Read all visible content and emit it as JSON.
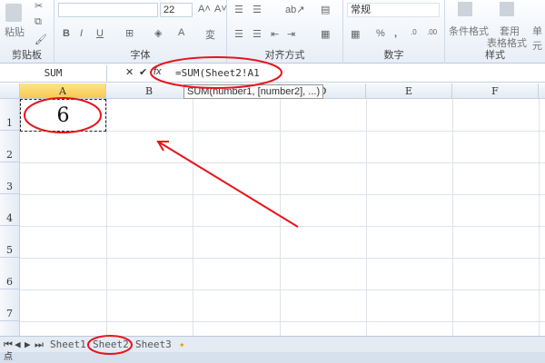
{
  "ribbon": {
    "clipboard": {
      "paste": "粘贴",
      "label": "剪贴板"
    },
    "font": {
      "font_name": "",
      "font_size": "22",
      "bold": "B",
      "italic": "I",
      "underline": "U",
      "label": "字体"
    },
    "alignment": {
      "label": "对齐方式"
    },
    "number": {
      "format": "常规",
      "percent": "%",
      "comma": ",",
      "label": "数字"
    },
    "styles": {
      "conditional": "条件格式",
      "table_line1": "套用",
      "table_line2": "表格格式",
      "cell": "单元",
      "label": "样式"
    }
  },
  "formula_bar": {
    "name_box": "SUM",
    "fx": "fx",
    "formula": "=SUM(Sheet2!A1",
    "tooltip": "SUM(number1, [number2], ...)"
  },
  "grid": {
    "columns": [
      "A",
      "B",
      "C",
      "D",
      "E",
      "F"
    ],
    "rows": [
      "1",
      "2",
      "3",
      "4",
      "5",
      "6",
      "7"
    ],
    "cell_a1": "6",
    "selected_column": "A"
  },
  "sheets": [
    "Sheet1",
    "Sheet2",
    "Sheet3"
  ],
  "status": {
    "mode": "点"
  },
  "annotations": {
    "color": "#e8141b"
  }
}
